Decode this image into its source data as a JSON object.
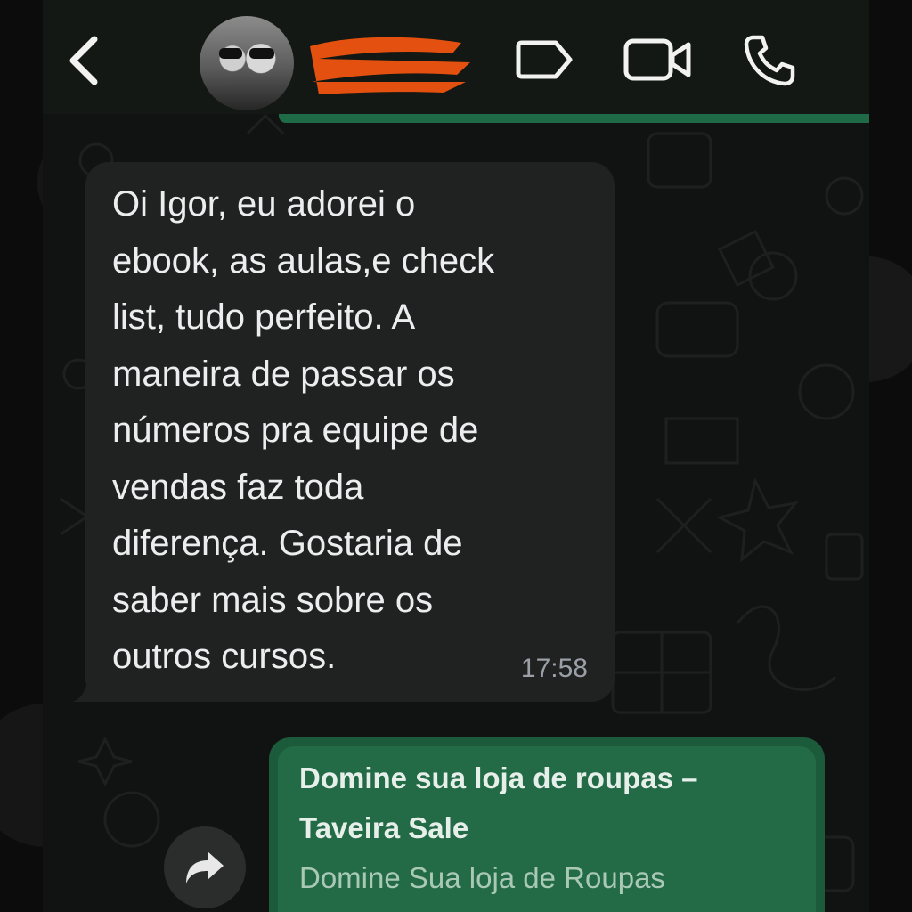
{
  "header": {
    "back_icon": "chevron-left-icon",
    "avatar": "contact-avatar-photo",
    "contact_name_redacted": true,
    "actions": [
      {
        "name": "label-tag-icon"
      },
      {
        "name": "video-call-icon"
      },
      {
        "name": "voice-call-icon"
      }
    ]
  },
  "messages": [
    {
      "direction": "incoming",
      "text": "Oi Igor, eu adorei o\nebook, as aulas,e check\nlist, tudo perfeito. A\nmaneira de passar os\nnúmeros pra equipe de\nvendas faz toda\ndiferença. Gostaria de\nsaber mais sobre os\noutros cursos.",
      "time": "17:58"
    },
    {
      "direction": "outgoing",
      "link_preview": {
        "title": "Domine sua loja de roupas –\nTaveira Sale",
        "description": "Domine Sua loja de Roupas"
      }
    }
  ],
  "forward_icon": "forward-arrow-icon",
  "colors": {
    "header_bg": "#131814",
    "chat_bg": "#111312",
    "incoming_bubble": "#1f2221",
    "outgoing_bubble": "#1b5a3b",
    "accent_green": "#1f6a47",
    "redaction": "#e4500f"
  }
}
